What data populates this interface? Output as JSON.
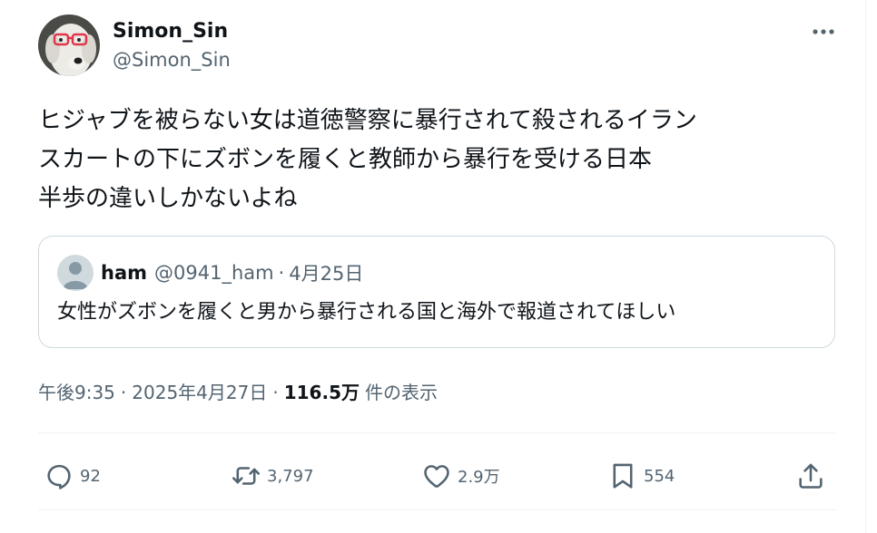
{
  "author": {
    "display_name": "Simon_Sin",
    "handle": "@Simon_Sin"
  },
  "tweet": {
    "lines": [
      "ヒジャブを被らない女は道徳警察に暴行されて殺されるイラン",
      "スカートの下にズボンを履くと教師から暴行を受ける日本",
      "半歩の違いしかないよね"
    ]
  },
  "quote": {
    "display_name": "ham",
    "handle": "@0941_ham",
    "separator": "·",
    "date": "4月25日",
    "text": "女性がズボンを履くと男から暴行される国と海外で報道されてほしい"
  },
  "meta": {
    "time": "午後9:35",
    "separator": "·",
    "date": "2025年4月27日",
    "views_count": "116.5万",
    "views_label": "件の表示"
  },
  "actions": {
    "reply_count": "92",
    "retweet_count": "3,797",
    "like_count": "2.9万",
    "bookmark_count": "554"
  },
  "icons": {
    "more": "more-horizontal-icon",
    "reply": "reply-icon",
    "retweet": "retweet-icon",
    "like": "heart-icon",
    "bookmark": "bookmark-icon",
    "share": "share-icon"
  },
  "colors": {
    "text_primary": "#0f1419",
    "text_secondary": "#536471",
    "border": "#cfd9de",
    "glasses_red": "#e0364b"
  }
}
